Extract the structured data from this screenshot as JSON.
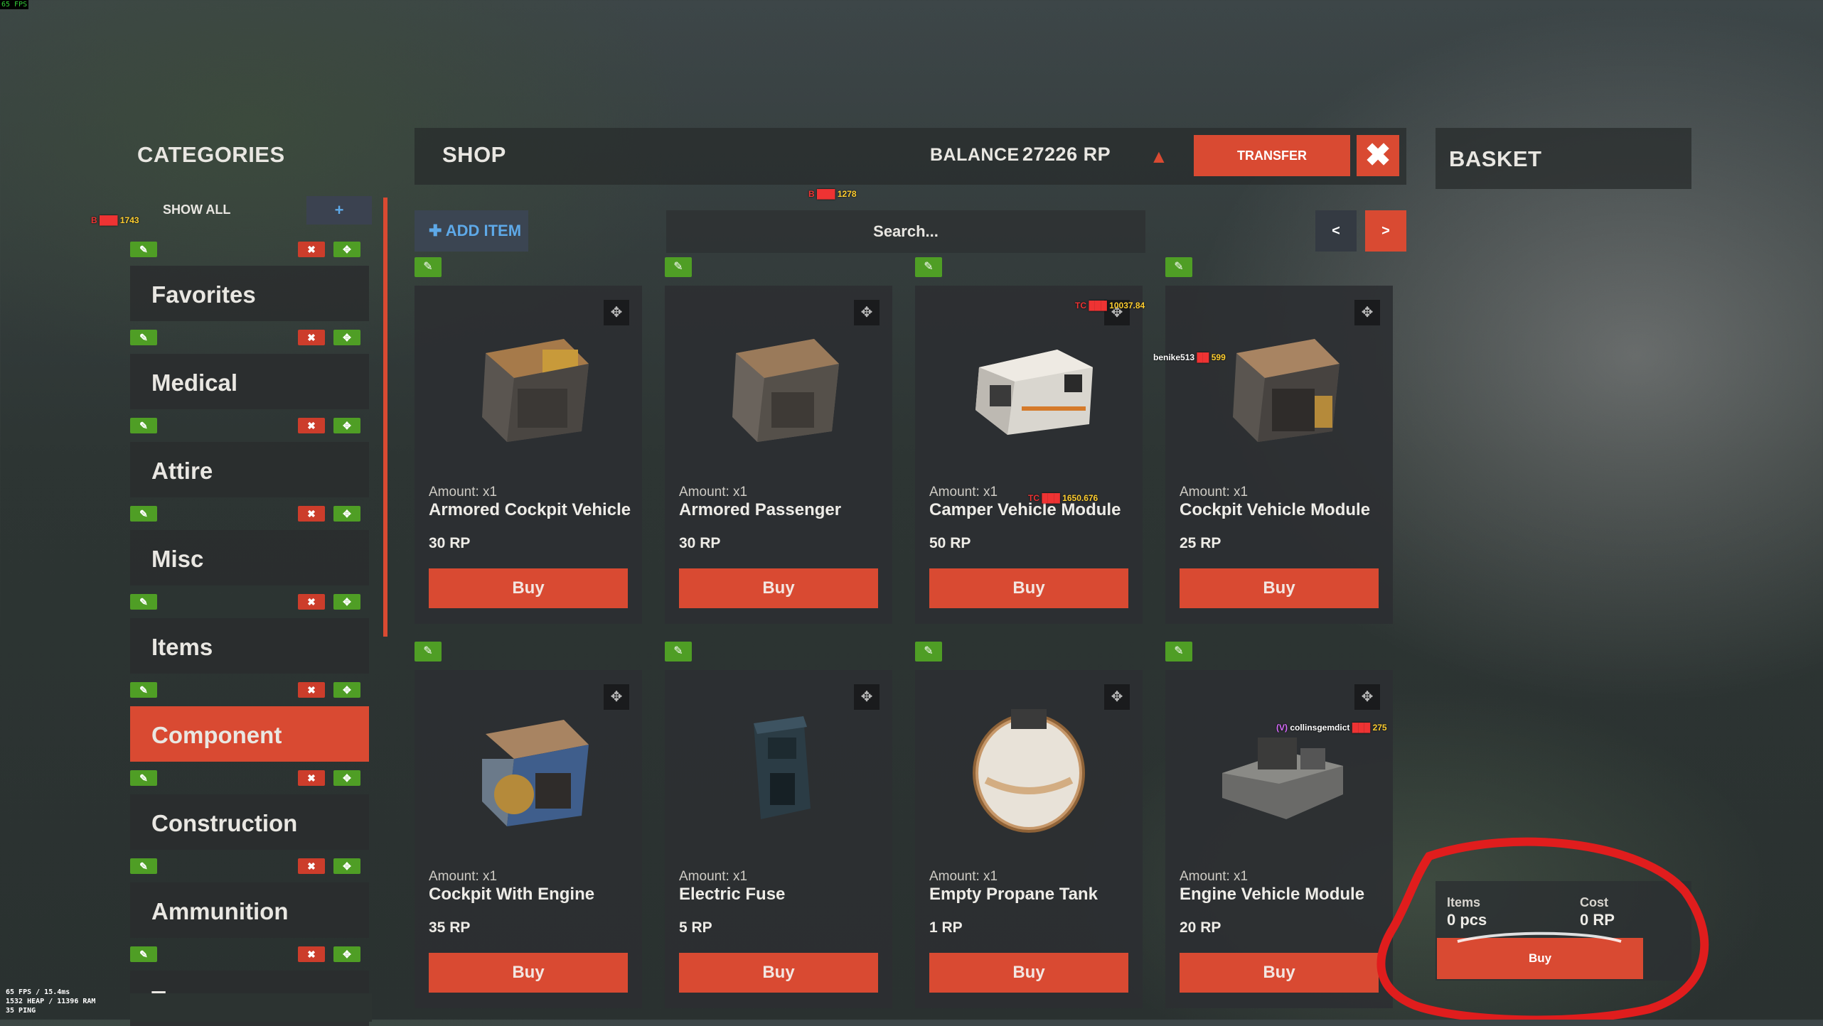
{
  "overlay": {
    "fps_top": "65 FPS",
    "perf_lines": [
      "65 FPS / 15.4ms",
      "1532 HEAP / 11396 RAM",
      "35 PING"
    ]
  },
  "categories": {
    "title": "CATEGORIES",
    "show_all": "SHOW ALL",
    "add_label": "+",
    "items": [
      {
        "label": "Favorites",
        "active": false
      },
      {
        "label": "Medical",
        "active": false
      },
      {
        "label": "Attire",
        "active": false
      },
      {
        "label": "Misc",
        "active": false
      },
      {
        "label": "Items",
        "active": false
      },
      {
        "label": "Component",
        "active": true
      },
      {
        "label": "Construction",
        "active": false
      },
      {
        "label": "Ammunition",
        "active": false
      },
      {
        "label": "Traps",
        "active": false
      }
    ]
  },
  "shop": {
    "title": "SHOP",
    "balance_label": "BALANCE",
    "balance_value": "27226 RP",
    "transfer_label": "TRANSFER",
    "add_item_label": "ADD ITEM",
    "search_placeholder": "Search...",
    "prev_label": "<",
    "next_label": ">",
    "buy_label": "Buy",
    "items": [
      {
        "amount": "Amount: x1",
        "name": "Armored Cockpit Vehicle",
        "price": "30 RP",
        "image": "armored-cockpit"
      },
      {
        "amount": "Amount: x1",
        "name": "Armored Passenger",
        "price": "30 RP",
        "image": "armored-passenger"
      },
      {
        "amount": "Amount: x1",
        "name": "Camper Vehicle Module",
        "price": "50 RP",
        "image": "camper"
      },
      {
        "amount": "Amount: x1",
        "name": "Cockpit Vehicle Module",
        "price": "25 RP",
        "image": "cockpit"
      },
      {
        "amount": "Amount: x1",
        "name": "Cockpit With Engine",
        "price": "35 RP",
        "image": "cockpit-engine"
      },
      {
        "amount": "Amount: x1",
        "name": "Electric Fuse",
        "price": "5 RP",
        "image": "fuse"
      },
      {
        "amount": "Amount: x1",
        "name": "Empty Propane Tank",
        "price": "1 RP",
        "image": "propane"
      },
      {
        "amount": "Amount: x1",
        "name": "Engine Vehicle Module",
        "price": "20 RP",
        "image": "engine"
      }
    ]
  },
  "basket": {
    "title": "BASKET",
    "items_label": "Items",
    "items_value": "0 pcs",
    "cost_label": "Cost",
    "cost_value": "0 RP",
    "buy_label": "Buy"
  },
  "player_tags": [
    {
      "text": "1743"
    },
    {
      "text": "1278"
    },
    {
      "text": "10037.84"
    },
    {
      "text": "benike513"
    },
    {
      "text": "599"
    },
    {
      "text": "1650.676"
    },
    {
      "text": "collinsgemdict"
    },
    {
      "text": "275"
    }
  ],
  "colors": {
    "accent": "#d94a32",
    "edit_green": "#4f9e25",
    "link_blue": "#5ea9e8",
    "panel": "#2c2f32"
  }
}
